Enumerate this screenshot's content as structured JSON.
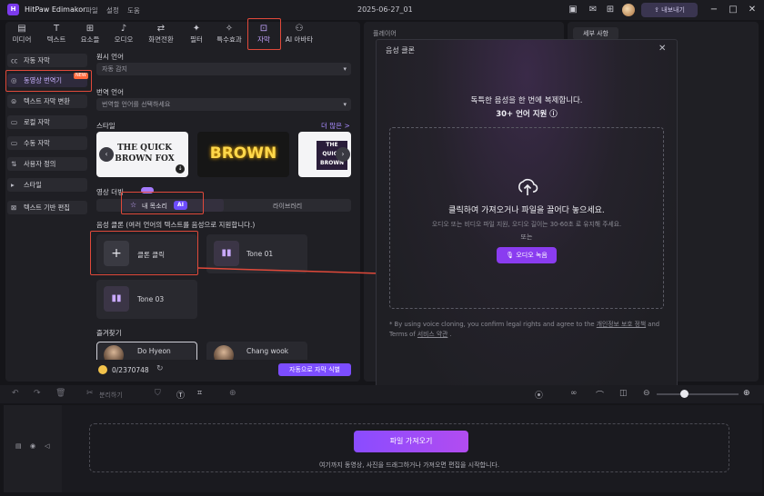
{
  "app": {
    "name": "HitPaw Edimakor",
    "menu": [
      "파일",
      "설정",
      "도움"
    ],
    "document_title": "2025-06-27_01",
    "export_label": "내보내기"
  },
  "toolbar": [
    {
      "label": "미디어",
      "icon": "media-icon"
    },
    {
      "label": "텍스트",
      "icon": "text-icon"
    },
    {
      "label": "요소들",
      "icon": "elements-icon"
    },
    {
      "label": "오디오",
      "icon": "audio-icon"
    },
    {
      "label": "화면전환",
      "icon": "transition-icon"
    },
    {
      "label": "필터",
      "icon": "filter-icon"
    },
    {
      "label": "특수효과",
      "icon": "effects-icon"
    },
    {
      "label": "자막",
      "icon": "subtitle-icon",
      "active": true
    },
    {
      "label": "AI 아바타",
      "icon": "ai-avatar-icon"
    }
  ],
  "sidebar": [
    {
      "label": "자동 자막",
      "icon": "cc-icon"
    },
    {
      "label": "동영상 번역기",
      "icon": "translate-icon",
      "active": true,
      "badge": "NEW"
    },
    {
      "label": "텍스트 자막 변환",
      "icon": "text-convert-icon"
    },
    {
      "label": "로컬 자막",
      "icon": "local-icon"
    },
    {
      "label": "수동 자막",
      "icon": "manual-icon"
    },
    {
      "label": "사용자 정의",
      "icon": "custom-icon"
    },
    {
      "label": "스타일",
      "icon": "style-icon"
    },
    {
      "label": "텍스트 기반 편집",
      "icon": "text-edit-icon"
    }
  ],
  "form": {
    "source_lang_label": "원시 언어",
    "source_lang_value": "자동 감지",
    "target_lang_label": "번역 언어",
    "target_lang_placeholder": "번역할 언어를 선택하세요",
    "style_label": "스타일",
    "more_label": "더 많은 >",
    "style_cards": [
      "THE QUICK BROWN FOX",
      "BROWN",
      "THE QUICK BROWN"
    ],
    "dubbing_label": "영상 더빙",
    "seg_my_voice": "내 목소리",
    "seg_ai": "AI",
    "seg_library": "라이브러리",
    "clone_heading": "음성 클론 (여러 언어의 텍스트를 음성으로 지원합니다.)",
    "clone_click": "클론 클릭",
    "tones": [
      "Tone 01",
      "Tone 03"
    ],
    "favorites_label": "즐겨찾기",
    "favorites": [
      "Do Hyeon",
      "Chang wook"
    ],
    "credits": "0/2370748",
    "auto_subtitle_btn": "자동으로 자막 식별"
  },
  "player": {
    "label": "플레이어"
  },
  "details": {
    "tab": "세부 사항"
  },
  "modal": {
    "title": "음성 클론",
    "line1": "독특한 음성을 한 번에 복제합니다.",
    "line2": "30+ 언어 지원 ⓘ",
    "drop_main": "클릭하여 가져오거나 파일을 끌어다 놓으세요.",
    "drop_sub": "오디오 또는 비디오 파일 지원, 오디오 길이는 30-60초 로 유지해 주세요.",
    "or": "또는",
    "record": "오디오 녹음",
    "legal_pre": "* By using voice cloning, you confirm legal rights and agree to the",
    "legal_link1": "개인정보 보호 정책",
    "legal_mid": "and Terms of",
    "legal_link2": "서비스 약관",
    "legal_end": "."
  },
  "timeline": {
    "split_label": "분리하기",
    "import_btn": "파일 가져오기",
    "import_hint": "여기까지 동영상, 사진을 드래그하거나 가져오면 편집을 시작합니다."
  },
  "colors": {
    "accent": "#8a3cf0",
    "highlight": "#e0493a",
    "bg": "#151519"
  }
}
